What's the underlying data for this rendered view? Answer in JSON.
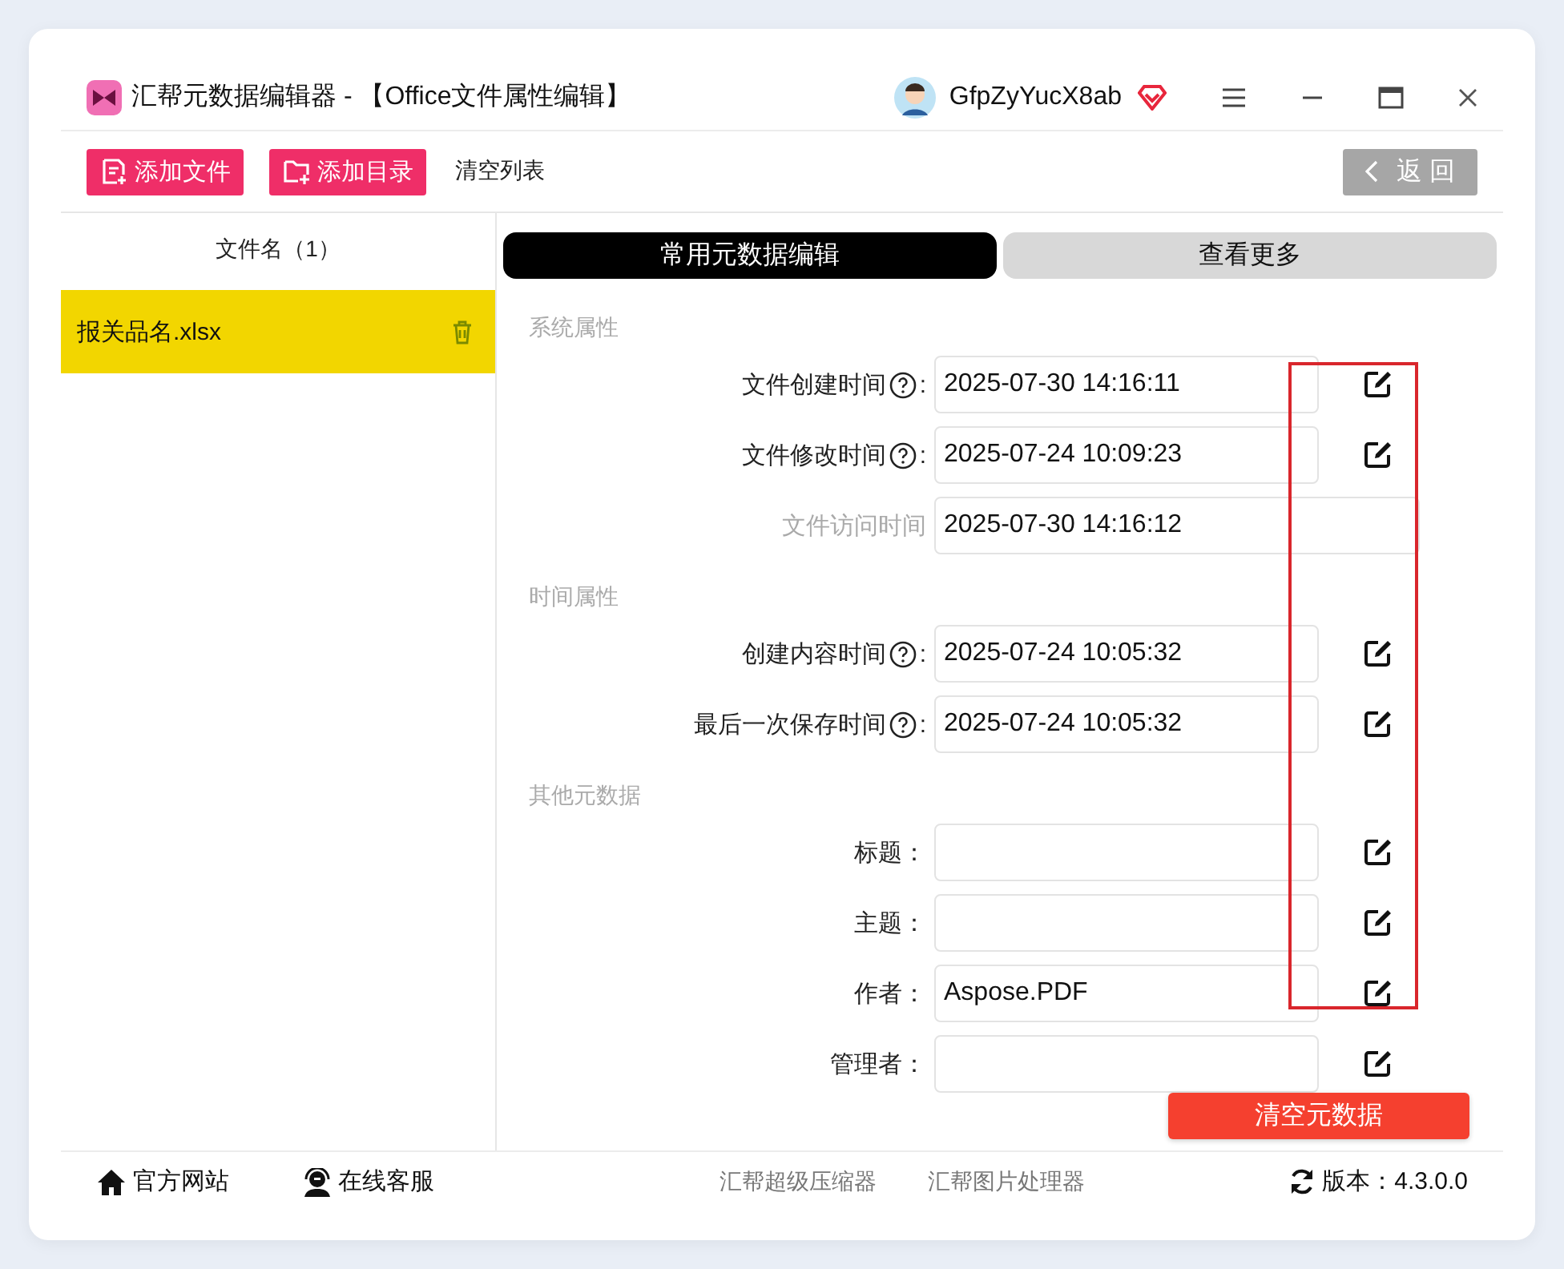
{
  "window": {
    "title": "汇帮元数据编辑器 - 【Office文件属性编辑】",
    "user": "GfpZyYucX8ab"
  },
  "toolbar": {
    "buttons": [
      {
        "label": "添加文件",
        "kind": "file"
      },
      {
        "label": "添加目录",
        "kind": "folder"
      },
      {
        "label": "清空列表",
        "kind": "text"
      }
    ],
    "back_button": {
      "label": "返 回",
      "disabled": true
    }
  },
  "file_list": {
    "header": "文件名（1）",
    "files": [
      {
        "name": "报关品名.xlsx",
        "selected": true
      }
    ]
  },
  "tabs": [
    {
      "label": "常用元数据编辑",
      "selected": true
    },
    {
      "label": "查看更多",
      "selected": false
    }
  ],
  "sections": [
    {
      "title": "系统属性",
      "fields": [
        {
          "label": "文件创建时间",
          "help": true,
          "colon": ":",
          "value": "2025-07-30 14:16:11",
          "editable": true
        },
        {
          "label": "文件修改时间",
          "help": true,
          "colon": ":",
          "value": "2025-07-24 10:09:23",
          "editable": true
        },
        {
          "label": "文件访问时间",
          "help": false,
          "value": "2025-07-30 14:16:12",
          "editable": false
        }
      ]
    },
    {
      "title": "时间属性",
      "fields": [
        {
          "label": "创建内容时间",
          "help": true,
          "colon": ":",
          "value": "2025-07-24 10:05:32",
          "editable": true
        },
        {
          "label": "最后一次保存时间",
          "help": true,
          "colon": ":",
          "value": "2025-07-24 10:05:32",
          "editable": true
        }
      ]
    },
    {
      "title": "其他元数据",
      "fields": [
        {
          "label": "标题：",
          "help": false,
          "editable": true
        },
        {
          "label": "主题：",
          "help": false,
          "editable": true
        },
        {
          "label": "作者：",
          "help": false,
          "value": "Aspose.PDF",
          "editable": true
        },
        {
          "label": "管理者：",
          "help": false,
          "editable": true
        }
      ]
    }
  ],
  "clear_button": "清空元数据",
  "footer": {
    "links": [
      {
        "label": "官方网站",
        "kind": "home"
      },
      {
        "label": "在线客服",
        "kind": "support"
      }
    ],
    "products": [
      "汇帮超级压缩器",
      "汇帮图片处理器"
    ],
    "version": "版本：4.3.0.0"
  }
}
